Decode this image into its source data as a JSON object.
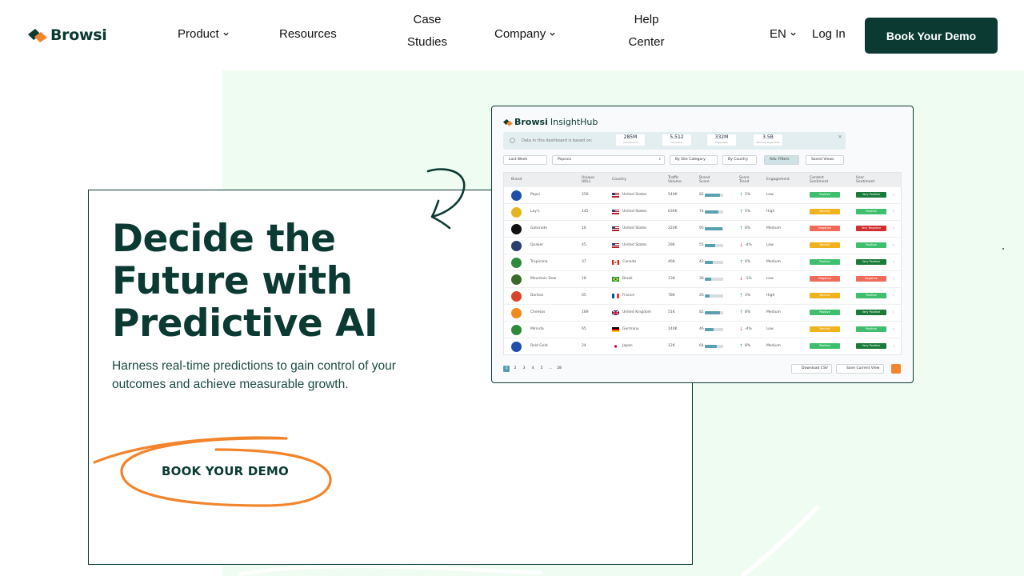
{
  "header": {
    "logo_text": "Browsi",
    "nav": {
      "product": "Product",
      "resources": "Resources",
      "case_studies_1": "Case",
      "case_studies_2": "Studies",
      "company": "Company",
      "help_1": "Help",
      "help_2": "Center"
    },
    "language": "EN",
    "login": "Log In",
    "cta": "Book Your Demo"
  },
  "hero": {
    "headline_1": "Decide the",
    "headline_2": "Future with",
    "headline_3": "Predictive AI",
    "subtext": "Harness real-time predictions to gain control of your outcomes and achieve measurable growth.",
    "cta": "BOOK YOUR DEMO"
  },
  "dashboard": {
    "brand": "Browsi",
    "product": "InsightHub",
    "info_label": "Data in this dashboard is based on:",
    "stats": [
      {
        "value": "285M",
        "label": "Impressions"
      },
      {
        "value": "5,512",
        "label": "Domains"
      },
      {
        "value": "332M",
        "label": "Pageviews"
      },
      {
        "value": "3.5B",
        "label": "Monthly Pageviews"
      }
    ],
    "filters": {
      "period": "Last Week",
      "search": "Pepsico",
      "site_category": "By Site Category",
      "country": "By Country",
      "adv_filters": "Adv. Filters",
      "saved_views": "Saved Views"
    },
    "columns": {
      "brand": "Brand",
      "unique_urls": "Unique URLs",
      "country": "Country",
      "traffic_volume": "Traffic Volume",
      "brand_score": "Brand Score",
      "score_trend": "Score Trend",
      "engagement": "Engagement",
      "content_sentiment": "Content Sentiment",
      "user_sentiment": "User Sentiment"
    },
    "rows": [
      {
        "brand": "Pepsi",
        "urls": "256",
        "country": "United States",
        "traffic": "540K",
        "score": "82",
        "score_pct": 0.82,
        "trend": "5%",
        "trend_dir": "up",
        "engagement": "Low",
        "content": "Positive",
        "user": "Very Positive",
        "icon_color": "#1f4fa8",
        "flag": "us"
      },
      {
        "brand": "Lay's",
        "urls": "145",
        "country": "United States",
        "traffic": "630K",
        "score": "74",
        "score_pct": 0.74,
        "trend": "5%",
        "trend_dir": "up",
        "engagement": "High",
        "content": "Neutral",
        "user": "Positive",
        "icon_color": "#e6b421",
        "flag": "us"
      },
      {
        "brand": "Gatorade",
        "urls": "16",
        "country": "United States",
        "traffic": "220K",
        "score": "95",
        "score_pct": 0.95,
        "trend": "8%",
        "trend_dir": "up",
        "engagement": "Medium",
        "content": "Negative",
        "user": "Very Negative",
        "icon_color": "#111111",
        "flag": "us"
      },
      {
        "brand": "Quaker",
        "urls": "45",
        "country": "United States",
        "traffic": "29K",
        "score": "55",
        "score_pct": 0.55,
        "trend": "-4%",
        "trend_dir": "down",
        "engagement": "Low",
        "content": "Neutral",
        "user": "Positive",
        "icon_color": "#2a3f6b",
        "flag": "us"
      },
      {
        "brand": "Tropicana",
        "urls": "37",
        "country": "Canada",
        "traffic": "46K",
        "score": "42",
        "score_pct": 0.42,
        "trend": "6%",
        "trend_dir": "up",
        "engagement": "Medium",
        "content": "Positive",
        "user": "Very Positive",
        "icon_color": "#2d8a3e",
        "flag": "ca"
      },
      {
        "brand": "Mountain Dew",
        "urls": "18",
        "country": "Brazil",
        "traffic": "13K",
        "score": "36",
        "score_pct": 0.36,
        "trend": "-1%",
        "trend_dir": "down",
        "engagement": "Low",
        "content": "Negative",
        "user": "Negative",
        "icon_color": "#3b6b2a",
        "flag": "br"
      },
      {
        "brand": "Doritos",
        "urls": "05",
        "country": "France",
        "traffic": "78K",
        "score": "26",
        "score_pct": 0.26,
        "trend": "3%",
        "trend_dir": "up",
        "engagement": "High",
        "content": "Neutral",
        "user": "Positive",
        "icon_color": "#d8452a",
        "flag": "fr"
      },
      {
        "brand": "Cheetos",
        "urls": "189",
        "country": "United Kingdom",
        "traffic": "51K",
        "score": "82",
        "score_pct": 0.82,
        "trend": "8%",
        "trend_dir": "up",
        "engagement": "Medium",
        "content": "Positive",
        "user": "Very Positive",
        "icon_color": "#f08a1c",
        "flag": "gb"
      },
      {
        "brand": "Mirinda",
        "urls": "65",
        "country": "Germany",
        "traffic": "140K",
        "score": "46",
        "score_pct": 0.46,
        "trend": "-4%",
        "trend_dir": "down",
        "engagement": "Low",
        "content": "Neutral",
        "user": "Positive",
        "icon_color": "#2e8a3b",
        "flag": "de"
      },
      {
        "brand": "Rold Gold",
        "urls": "24",
        "country": "Japan",
        "traffic": "12K",
        "score": "64",
        "score_pct": 0.64,
        "trend": "8%",
        "trend_dir": "up",
        "engagement": "Medium",
        "content": "Positive",
        "user": "Very Positive",
        "icon_color": "#1f4fa8",
        "flag": "jp"
      }
    ],
    "pager": [
      "1",
      "2",
      "3",
      "4",
      "5",
      "...",
      "28"
    ],
    "download": "Download CSV",
    "save_view": "Save Current View"
  },
  "colors": {
    "primary": "#0a3a32",
    "mint": "#effcf1",
    "accent_orange": "#f2852c",
    "positive": "#3fbf6e",
    "very_positive": "#1a7a3a",
    "neutral": "#f0b21e",
    "negative": "#f06a5a",
    "very_negative": "#d12d2d"
  }
}
